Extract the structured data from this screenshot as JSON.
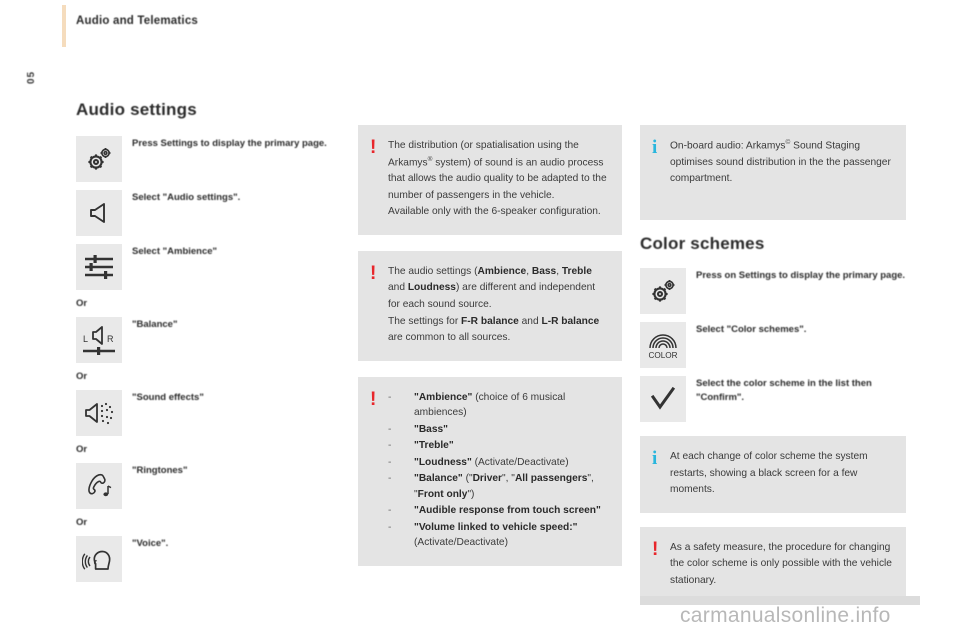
{
  "header": {
    "title": "Audio and Telematics",
    "side_tab": "05"
  },
  "audio_settings": {
    "title": "Audio settings",
    "steps": [
      {
        "icon": "gears-icon",
        "text": "Press Settings to display the primary page.",
        "or_before": ""
      },
      {
        "icon": "speaker-icon",
        "text": "Select \"Audio settings\".",
        "or_before": ""
      },
      {
        "icon": "equalizer-icon",
        "text": "Select \"Ambience\"",
        "or_before": ""
      },
      {
        "icon": "balance-lr-icon",
        "text": "\"Balance\"",
        "or_before": "Or"
      },
      {
        "icon": "sound-effects-icon",
        "text": "\"Sound effects\"",
        "or_before": "Or"
      },
      {
        "icon": "ringtones-icon",
        "text": "\"Ringtones\"",
        "or_before": "Or"
      },
      {
        "icon": "voice-icon",
        "text": "\"Voice\".",
        "or_before": "Or"
      }
    ]
  },
  "middle_callouts": [
    {
      "mark": "!",
      "mark_type": "warn",
      "paragraphs": [
        "The distribution (or spatialisation using the Arkamys<sup>®</sup> system) of sound is an audio process that allows the audio quality to be adapted to the number of passengers in the vehicle.",
        "Available only with the 6-speaker configuration."
      ]
    },
    {
      "mark": "!",
      "mark_type": "warn",
      "paragraphs": [
        "The audio settings (<b>Ambience</b>, <b>Bass</b>, <b>Treble</b> and <b>Loudness</b>) are different and independent for each sound source.",
        "The settings for <b>F-R balance</b> and <b>L-R balance</b> are common to all sources."
      ]
    }
  ],
  "settings_list": {
    "mark": "!",
    "mark_type": "warn",
    "dash": "-",
    "items": [
      "<b>\"Ambience\"</b> (choice of 6 musical ambiences)",
      "<b>\"Bass\"</b>",
      "<b>\"Treble\"</b>",
      "<b>\"Loudness\"</b> (Activate/Deactivate)",
      "<b>\"Balance\"</b> (\"<b>Driver</b>\", \"<b>All passengers</b>\", \"<b>Front only</b>\")",
      "<b>\"Audible response from touch screen\"</b>",
      "<b>\"Volume linked to vehicle speed:\"</b> (Activate/Deactivate)"
    ]
  },
  "right_top_callout": {
    "mark": "i",
    "mark_type": "info",
    "paragraphs": [
      "On-board audio: Arkamys<sup>©</sup> Sound Staging optimises sound distribution in the the passenger compartment."
    ]
  },
  "color_schemes": {
    "title": "Color schemes",
    "steps": [
      {
        "icon": "gears-icon",
        "text": "Press on Settings to display the primary page."
      },
      {
        "icon": "color-icon",
        "text": "Select \"Color schemes\"."
      },
      {
        "icon": "checkmark-icon",
        "text": "Select the color scheme in the list then \"Confirm\"."
      }
    ],
    "callouts": [
      {
        "mark": "i",
        "mark_type": "info",
        "paragraphs": [
          "At each change of color scheme the system restarts, showing a black screen for a few moments."
        ]
      },
      {
        "mark": "!",
        "mark_type": "warn",
        "paragraphs": [
          "As a safety measure, the procedure for changing the color scheme is only possible with the vehicle stationary."
        ]
      }
    ],
    "color_icon_label": "COLOR"
  },
  "watermark": "carmanualsonline.info",
  "colors": {
    "warn_red": "#e8262b",
    "info_blue": "#29b6dd",
    "callout_bg": "#e4e4e4",
    "icon_bg": "#e9e9e9",
    "header_rule": "#f5dcbd"
  }
}
